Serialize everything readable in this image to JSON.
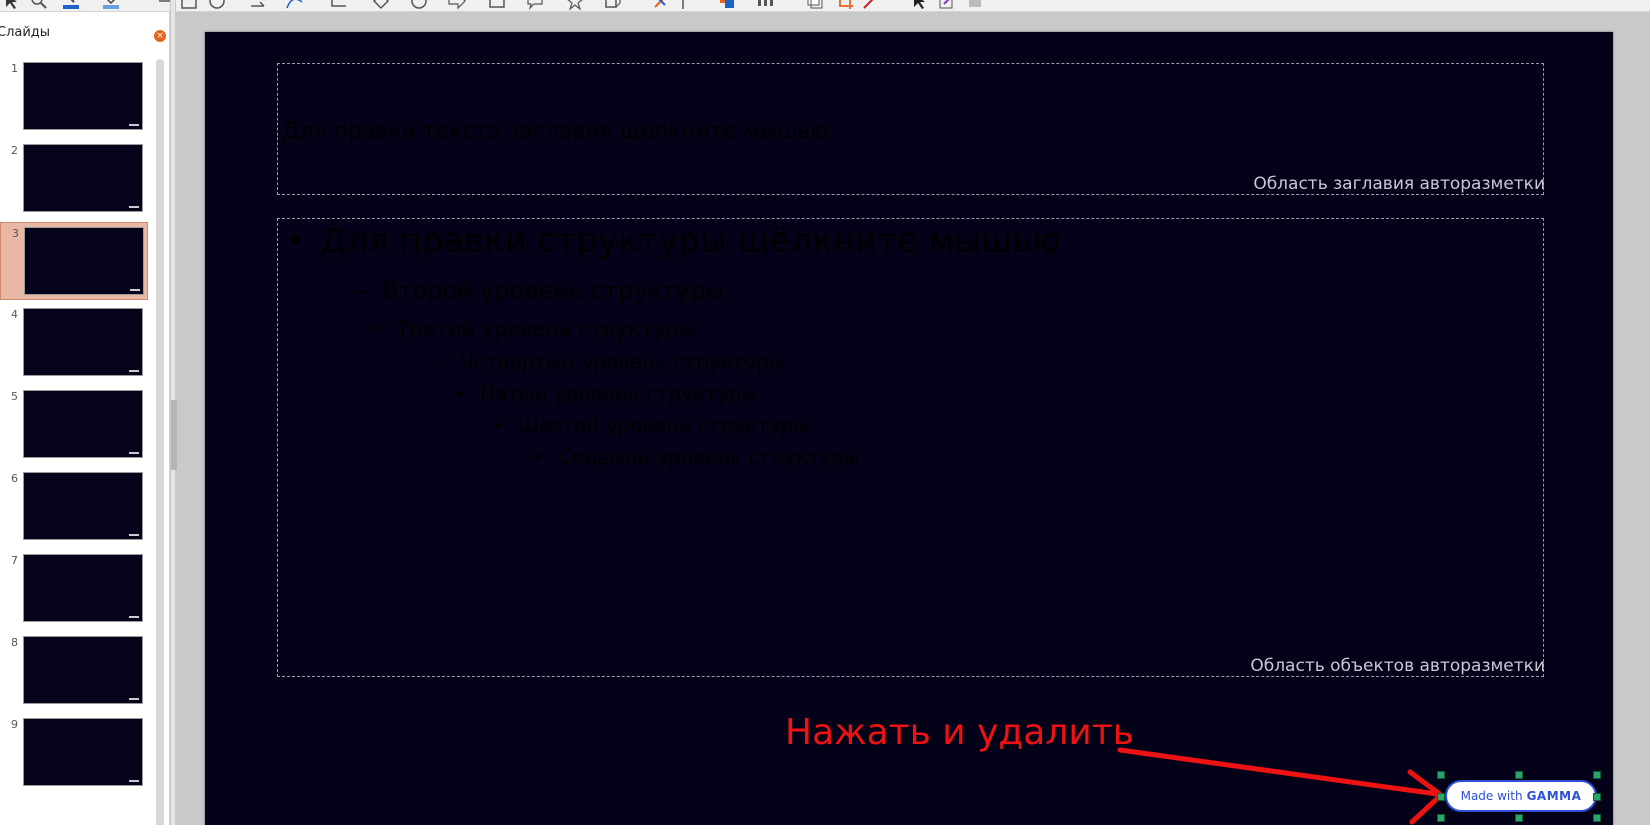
{
  "slides_pane": {
    "title": "Слайды",
    "close_icon": "close-icon",
    "slides": [
      {
        "number": "1",
        "selected": false
      },
      {
        "number": "2",
        "selected": false
      },
      {
        "number": "3",
        "selected": true
      },
      {
        "number": "4",
        "selected": false
      },
      {
        "number": "5",
        "selected": false
      },
      {
        "number": "6",
        "selected": false
      },
      {
        "number": "7",
        "selected": false
      },
      {
        "number": "8",
        "selected": false
      },
      {
        "number": "9",
        "selected": false
      }
    ]
  },
  "slide": {
    "background": "#030219",
    "title_placeholder": {
      "text": "Для правки текста заглавия щелкните мышью",
      "label": "Область заглавия авторазметки"
    },
    "content_placeholder": {
      "label": "Область объектов авторазметки",
      "levels": [
        "Для правки структуры щёлкните мышью",
        "Второй уровень структуры",
        "Третий уровень структуры",
        "Четвёртый уровень структуры",
        "Пятый уровень структуры",
        "Шестой уровень структуры",
        "Седьмой уровень структуры"
      ]
    },
    "annotation": {
      "text": "Нажать и удалить",
      "color": "#ee1212"
    },
    "badge": {
      "prefix": "Made with",
      "brand": "GAMMA",
      "color": "#2b4fd6"
    }
  }
}
